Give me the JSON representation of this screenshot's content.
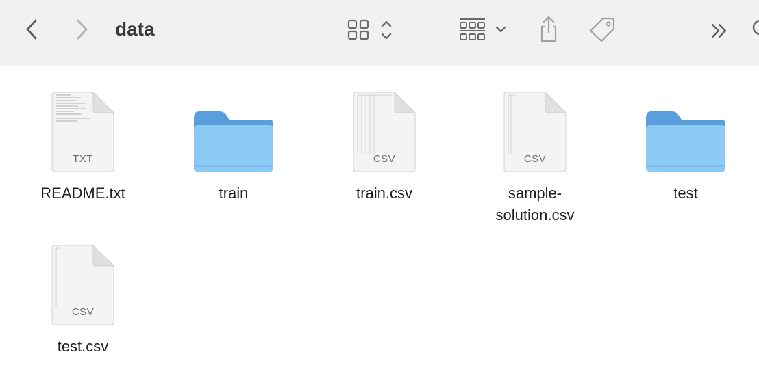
{
  "window": {
    "title": "data"
  },
  "toolbar": {
    "back_icon": "chevron-left-icon",
    "forward_icon": "chevron-right-icon",
    "view_icon": "icon-grid-view-icon",
    "group_icon": "group-by-icon",
    "share_icon": "share-icon",
    "tag_icon": "tag-icon",
    "more_icon": "double-chevron-right-icon",
    "search_icon": "search-icon"
  },
  "files": [
    {
      "name": "README.txt",
      "kind": "document",
      "ext": "TXT"
    },
    {
      "name": "train",
      "kind": "folder",
      "ext": ""
    },
    {
      "name": "train.csv",
      "kind": "document",
      "ext": "CSV"
    },
    {
      "name": "sample-solution.csv",
      "kind": "document",
      "ext": "CSV"
    },
    {
      "name": "test",
      "kind": "folder",
      "ext": ""
    },
    {
      "name": "test.csv",
      "kind": "document",
      "ext": "CSV"
    }
  ],
  "colors": {
    "toolbar_bg": "#f2f1f0",
    "icon_gray": "#6f6f6f",
    "folder_front": "#8ccaf5",
    "folder_back": "#5a9fdc"
  }
}
